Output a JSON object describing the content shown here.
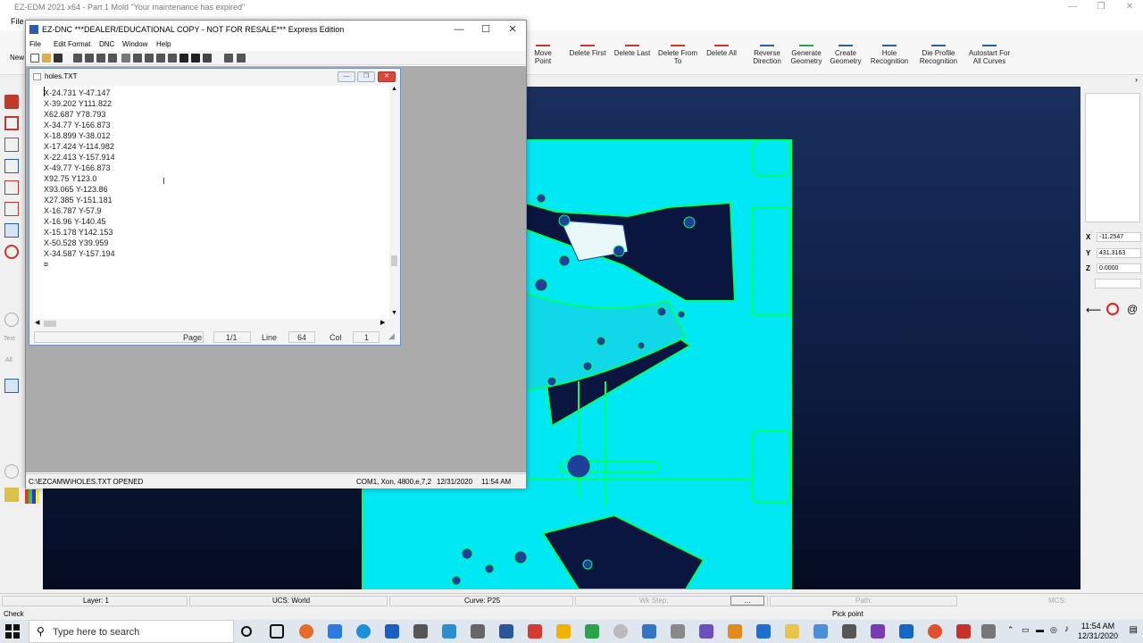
{
  "app": {
    "title": "EZ-EDM 2021 x64 - Part 1 Mold  \"Your maintenance has expired\"",
    "menu_file": "File",
    "ribbon_new": "New",
    "ribbon_buttons": [
      {
        "label": "Move Point",
        "icon": "move-point-icon"
      },
      {
        "label": "Delete First",
        "icon": "delete-first-icon"
      },
      {
        "label": "Delete Last",
        "icon": "delete-last-icon"
      },
      {
        "label": "Delete From To",
        "icon": "delete-from-to-icon"
      },
      {
        "label": "Delete All",
        "icon": "delete-all-icon"
      },
      {
        "label": "Reverse Direction",
        "icon": "reverse-direction-icon"
      },
      {
        "label": "Generate Geometry",
        "icon": "generate-geometry-icon"
      },
      {
        "label": "Create Geometry",
        "icon": "create-geometry-icon"
      },
      {
        "label": "Hole Recognition",
        "icon": "hole-recognition-icon"
      },
      {
        "label": "Die Profile Recognition",
        "icon": "die-profile-icon"
      },
      {
        "label": "Autostart For All Curves",
        "icon": "autostart-icon"
      }
    ],
    "left_labels": [
      "Text",
      "All"
    ],
    "coords": {
      "x_label": "X",
      "x": "-11.2547",
      "y_label": "Y",
      "y": "431.3163",
      "z_label": "Z",
      "z": "0.0000"
    },
    "status": {
      "layer": "Layer: 1",
      "ucs": "UCS: World",
      "curve": "Curve: P25",
      "wk_step": "Wk Step:",
      "dots": "...",
      "path": "Path:",
      "mcs": "MCS:"
    },
    "status2": {
      "left": "Check",
      "mid": "Pick point"
    }
  },
  "dnc": {
    "title": "EZ-DNC   ***DEALER/EDUCATIONAL COPY - NOT FOR RESALE***   Express Edition",
    "menu": [
      "File",
      "Edit",
      "Format",
      "DNC",
      "Window",
      "Help"
    ],
    "child_title": "holes.TXT",
    "lines": [
      "X-24.731 Y-47.147",
      "X-39.202 Y111.822",
      "X62.687 Y78.793",
      "X-34.77 Y-166.873",
      "X-18.899 Y-38.012",
      "X-17.424 Y-114.982",
      "X-22.413 Y-157.914",
      "X-49.77 Y-166.873",
      "X92.75 Y123.0",
      "X93.065 Y-123.86",
      "X27.385 Y-151.181",
      "X-16.787 Y-57.9",
      "X-16.96 Y-140.45",
      "X-15.178 Y142.153",
      "X-50.528 Y39.959",
      "X-34.587 Y-157.194",
      "¤"
    ],
    "page_label": "Page",
    "page_value": "1/1",
    "line_label": "Line",
    "line_value": "64",
    "col_label": "Col",
    "col_value": "1",
    "status_path": "C:\\EZCAMW\\HOLES.TXT OPENED",
    "status_com": "COM1, Xon, 4800,e,7,2",
    "status_date": "12/31/2020",
    "status_time": "11:54 AM"
  },
  "taskbar": {
    "search_placeholder": "Type here to search",
    "time": "11:54 AM",
    "date": "12/31/2020"
  },
  "colors": {
    "accent": "#2a5ea8",
    "part": "#00f0ff",
    "edge": "#00ff66",
    "hole": "#1e3f9a"
  }
}
